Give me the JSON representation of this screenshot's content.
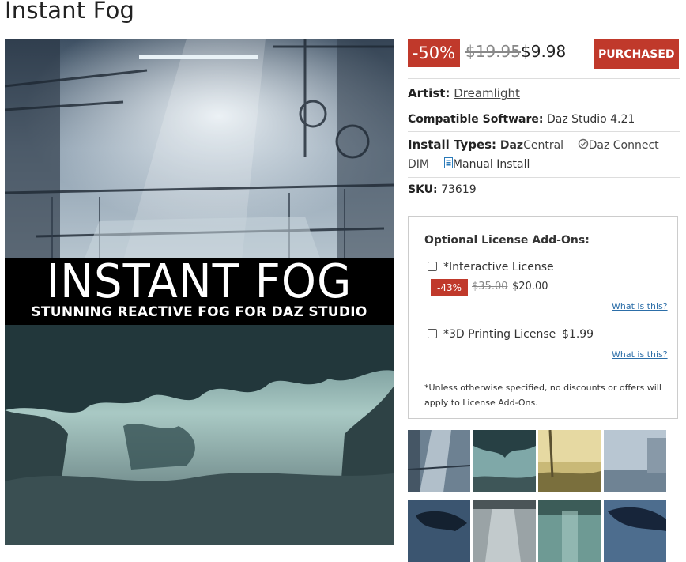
{
  "product": {
    "title": "Instant Fog"
  },
  "hero": {
    "banner_title": "INSTANT FOG",
    "banner_subtitle": "STUNNING REACTIVE FOG FOR DAZ STUDIO"
  },
  "pricing": {
    "discount": "-50%",
    "old_price": "$19.95",
    "new_price": "$9.98",
    "button_label": "PURCHASED",
    "accent_color": "#c0392b"
  },
  "details": {
    "artist_label": "Artist:",
    "artist_name": "Dreamlight",
    "software_label": "Compatible Software:",
    "software_value": "Daz Studio 4.21",
    "install_label": "Install Types:",
    "install_dazcentral_bold": "Daz",
    "install_dazcentral_light": "Central",
    "install_daz_connect": "Daz Connect",
    "install_dim": "DIM",
    "install_manual": "Manual Install",
    "sku_label": "SKU:",
    "sku_value": "73619"
  },
  "addons": {
    "title": "Optional License Add-Ons:",
    "items": [
      {
        "label": "*Interactive License",
        "discount": "-43%",
        "old_price": "$35.00",
        "new_price": "$20.00",
        "link": "What is this?",
        "checked": false
      },
      {
        "label": "*3D Printing License",
        "price": "$1.99",
        "link": "What is this?",
        "checked": false
      }
    ],
    "footnote": "*Unless otherwise specified, no discounts or offers will apply to License Add-Ons."
  },
  "thumbnails": [
    {
      "icon": "thumbnail-industrial-light"
    },
    {
      "icon": "thumbnail-cave-arch"
    },
    {
      "icon": "thumbnail-forest-fog"
    },
    {
      "icon": "thumbnail-courtyard"
    },
    {
      "icon": "thumbnail-dark-ship"
    },
    {
      "icon": "thumbnail-hall-light"
    },
    {
      "icon": "thumbnail-teal-room"
    },
    {
      "icon": "thumbnail-dark-ship-2"
    }
  ]
}
